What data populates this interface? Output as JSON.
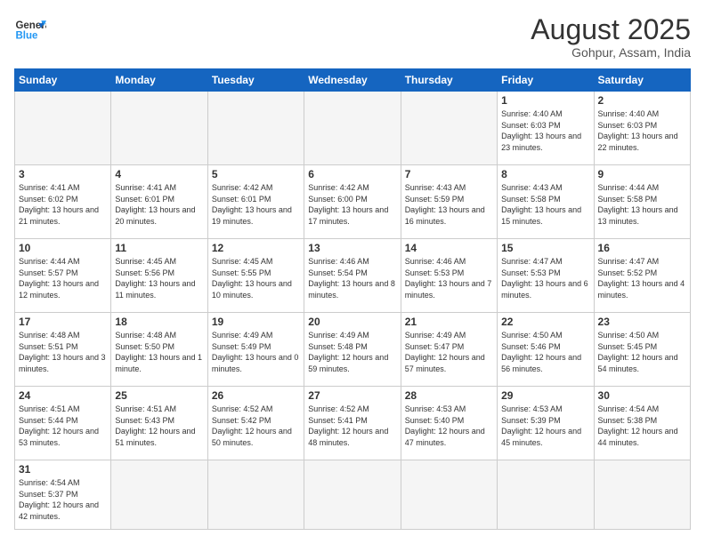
{
  "header": {
    "logo_general": "General",
    "logo_blue": "Blue",
    "month_title": "August 2025",
    "subtitle": "Gohpur, Assam, India"
  },
  "weekdays": [
    "Sunday",
    "Monday",
    "Tuesday",
    "Wednesday",
    "Thursday",
    "Friday",
    "Saturday"
  ],
  "weeks": [
    [
      {
        "day": "",
        "info": ""
      },
      {
        "day": "",
        "info": ""
      },
      {
        "day": "",
        "info": ""
      },
      {
        "day": "",
        "info": ""
      },
      {
        "day": "",
        "info": ""
      },
      {
        "day": "1",
        "info": "Sunrise: 4:40 AM\nSunset: 6:03 PM\nDaylight: 13 hours and 23 minutes."
      },
      {
        "day": "2",
        "info": "Sunrise: 4:40 AM\nSunset: 6:03 PM\nDaylight: 13 hours and 22 minutes."
      }
    ],
    [
      {
        "day": "3",
        "info": "Sunrise: 4:41 AM\nSunset: 6:02 PM\nDaylight: 13 hours and 21 minutes."
      },
      {
        "day": "4",
        "info": "Sunrise: 4:41 AM\nSunset: 6:01 PM\nDaylight: 13 hours and 20 minutes."
      },
      {
        "day": "5",
        "info": "Sunrise: 4:42 AM\nSunset: 6:01 PM\nDaylight: 13 hours and 19 minutes."
      },
      {
        "day": "6",
        "info": "Sunrise: 4:42 AM\nSunset: 6:00 PM\nDaylight: 13 hours and 17 minutes."
      },
      {
        "day": "7",
        "info": "Sunrise: 4:43 AM\nSunset: 5:59 PM\nDaylight: 13 hours and 16 minutes."
      },
      {
        "day": "8",
        "info": "Sunrise: 4:43 AM\nSunset: 5:58 PM\nDaylight: 13 hours and 15 minutes."
      },
      {
        "day": "9",
        "info": "Sunrise: 4:44 AM\nSunset: 5:58 PM\nDaylight: 13 hours and 13 minutes."
      }
    ],
    [
      {
        "day": "10",
        "info": "Sunrise: 4:44 AM\nSunset: 5:57 PM\nDaylight: 13 hours and 12 minutes."
      },
      {
        "day": "11",
        "info": "Sunrise: 4:45 AM\nSunset: 5:56 PM\nDaylight: 13 hours and 11 minutes."
      },
      {
        "day": "12",
        "info": "Sunrise: 4:45 AM\nSunset: 5:55 PM\nDaylight: 13 hours and 10 minutes."
      },
      {
        "day": "13",
        "info": "Sunrise: 4:46 AM\nSunset: 5:54 PM\nDaylight: 13 hours and 8 minutes."
      },
      {
        "day": "14",
        "info": "Sunrise: 4:46 AM\nSunset: 5:53 PM\nDaylight: 13 hours and 7 minutes."
      },
      {
        "day": "15",
        "info": "Sunrise: 4:47 AM\nSunset: 5:53 PM\nDaylight: 13 hours and 6 minutes."
      },
      {
        "day": "16",
        "info": "Sunrise: 4:47 AM\nSunset: 5:52 PM\nDaylight: 13 hours and 4 minutes."
      }
    ],
    [
      {
        "day": "17",
        "info": "Sunrise: 4:48 AM\nSunset: 5:51 PM\nDaylight: 13 hours and 3 minutes."
      },
      {
        "day": "18",
        "info": "Sunrise: 4:48 AM\nSunset: 5:50 PM\nDaylight: 13 hours and 1 minute."
      },
      {
        "day": "19",
        "info": "Sunrise: 4:49 AM\nSunset: 5:49 PM\nDaylight: 13 hours and 0 minutes."
      },
      {
        "day": "20",
        "info": "Sunrise: 4:49 AM\nSunset: 5:48 PM\nDaylight: 12 hours and 59 minutes."
      },
      {
        "day": "21",
        "info": "Sunrise: 4:49 AM\nSunset: 5:47 PM\nDaylight: 12 hours and 57 minutes."
      },
      {
        "day": "22",
        "info": "Sunrise: 4:50 AM\nSunset: 5:46 PM\nDaylight: 12 hours and 56 minutes."
      },
      {
        "day": "23",
        "info": "Sunrise: 4:50 AM\nSunset: 5:45 PM\nDaylight: 12 hours and 54 minutes."
      }
    ],
    [
      {
        "day": "24",
        "info": "Sunrise: 4:51 AM\nSunset: 5:44 PM\nDaylight: 12 hours and 53 minutes."
      },
      {
        "day": "25",
        "info": "Sunrise: 4:51 AM\nSunset: 5:43 PM\nDaylight: 12 hours and 51 minutes."
      },
      {
        "day": "26",
        "info": "Sunrise: 4:52 AM\nSunset: 5:42 PM\nDaylight: 12 hours and 50 minutes."
      },
      {
        "day": "27",
        "info": "Sunrise: 4:52 AM\nSunset: 5:41 PM\nDaylight: 12 hours and 48 minutes."
      },
      {
        "day": "28",
        "info": "Sunrise: 4:53 AM\nSunset: 5:40 PM\nDaylight: 12 hours and 47 minutes."
      },
      {
        "day": "29",
        "info": "Sunrise: 4:53 AM\nSunset: 5:39 PM\nDaylight: 12 hours and 45 minutes."
      },
      {
        "day": "30",
        "info": "Sunrise: 4:54 AM\nSunset: 5:38 PM\nDaylight: 12 hours and 44 minutes."
      }
    ],
    [
      {
        "day": "31",
        "info": "Sunrise: 4:54 AM\nSunset: 5:37 PM\nDaylight: 12 hours and 42 minutes."
      },
      {
        "day": "",
        "info": ""
      },
      {
        "day": "",
        "info": ""
      },
      {
        "day": "",
        "info": ""
      },
      {
        "day": "",
        "info": ""
      },
      {
        "day": "",
        "info": ""
      },
      {
        "day": "",
        "info": ""
      }
    ]
  ]
}
